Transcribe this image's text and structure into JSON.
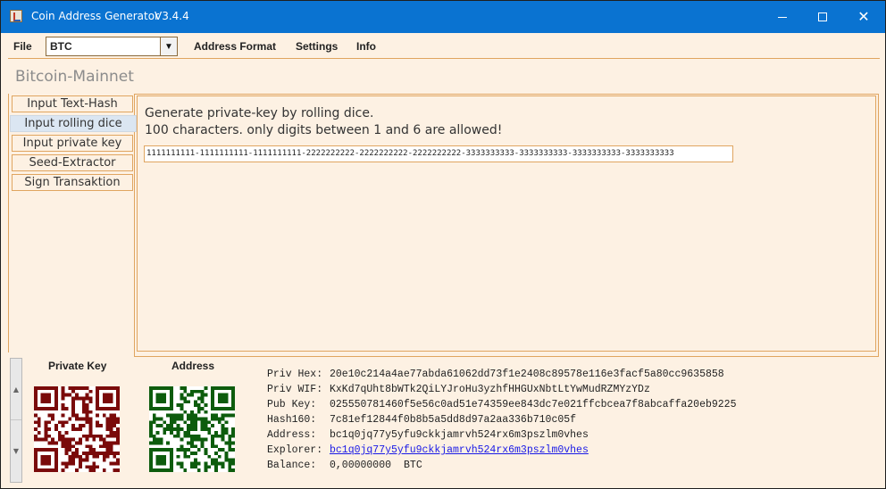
{
  "window": {
    "title": "Coin Address Generator",
    "version": "V3.4.4",
    "controls": {
      "minimize": "–",
      "maximize": "□",
      "close": "✕"
    }
  },
  "menu": {
    "file": "File",
    "coin_selected": "BTC",
    "address_format": "Address Format",
    "settings": "Settings",
    "info": "Info"
  },
  "network": "Bitcoin-Mainnet",
  "tabs": [
    {
      "label": "Input Text-Hash",
      "active": false
    },
    {
      "label": "Input rolling dice",
      "active": true
    },
    {
      "label": "Input private key",
      "active": false
    },
    {
      "label": "Seed-Extractor",
      "active": false
    },
    {
      "label": "Sign Transaktion",
      "active": false
    }
  ],
  "panel": {
    "line1": "Generate private-key by rolling dice.",
    "line2": "100 characters. only digits between 1 and 6 are allowed!",
    "dice_value": "1111111111-1111111111-1111111111-2222222222-2222222222-2222222222-3333333333-3333333333-3333333333-3333333333"
  },
  "qr": {
    "private_key_label": "Private Key",
    "address_label": "Address",
    "private_key_color": "#7a0a0a",
    "address_color": "#0d5c0d"
  },
  "info": [
    {
      "key": "Priv Hex:",
      "value": "20e10c214a4ae77abda61062dd73f1e2408c89578e116e3facf5a80cc9635858"
    },
    {
      "key": "Priv WIF:",
      "value": "KxKd7qUht8bWTk2QiLYJroHu3yzhfHHGUxNbtLtYwMudRZMYzYDz"
    },
    {
      "key": "Pub Key:",
      "value": "025550781460f5e56c0ad51e74359ee843dc7e021ffcbcea7f8abcaffa20eb9225"
    },
    {
      "key": "Hash160:",
      "value": "7c81ef12844f0b8b5a5dd8d97a2aa336b710c05f"
    },
    {
      "key": "Address:",
      "value": "bc1q0jq77y5yfu9ckkjamrvh524rx6m3pszlm0vhes"
    },
    {
      "key": "Explorer:",
      "value": "bc1q0jq77y5yfu9ckkjamrvh524rx6m3pszlm0vhes",
      "link": true
    },
    {
      "key": "Balance:",
      "value": "0,00000000",
      "unit": "BTC"
    }
  ],
  "scrollbar": {
    "up_icon": "triangle-up",
    "down_icon": "triangle-down"
  }
}
